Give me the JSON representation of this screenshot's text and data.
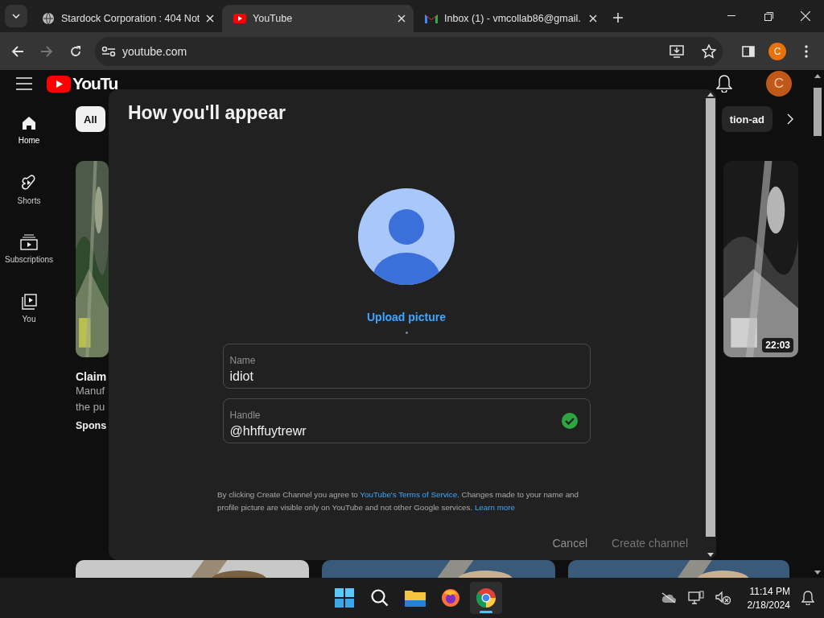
{
  "browser": {
    "tabs": [
      {
        "title": "Stardock Corporation : 404 Not",
        "kind": "globe",
        "selected": false
      },
      {
        "title": "YouTube",
        "kind": "youtube",
        "selected": true
      },
      {
        "title": "Inbox (1) - vmcollab86@gmail.",
        "kind": "gmail",
        "selected": false
      }
    ],
    "address": "youtube.com",
    "profile": "C"
  },
  "youtube": {
    "logo_text": "YouTu",
    "avatar": "C",
    "sidebar": [
      {
        "label": "Home",
        "kind": "home",
        "selected": true
      },
      {
        "label": "Shorts",
        "kind": "shorts",
        "selected": false
      },
      {
        "label": "Subscriptions",
        "kind": "subscriptions",
        "selected": false
      },
      {
        "label": "You",
        "kind": "you",
        "selected": false
      }
    ],
    "chips": [
      {
        "label": "All",
        "selected": true
      },
      {
        "label": "tion-ad",
        "selected": false
      }
    ],
    "left_video": {
      "title": "Claim",
      "description": [
        "Manuf",
        "the pu"
      ],
      "sponsor": "Spons"
    },
    "right_video": {
      "duration": "22:03"
    }
  },
  "dialog": {
    "title": "How you'll appear",
    "upload": "Upload picture",
    "fields": [
      {
        "label": "Name",
        "value": "idiot",
        "valid": false
      },
      {
        "label": "Handle",
        "value": "@hhffuytrewr",
        "valid": true
      }
    ],
    "legal": [
      {
        "text": "By clicking Create Channel you agree to ",
        "kind": "text"
      },
      {
        "text": "YouTube's Terms of Service",
        "kind": "link"
      },
      {
        "text": ". Changes made to your name and profile picture are visible only on YouTube and not other Google services. ",
        "kind": "text"
      },
      {
        "text": "Learn more",
        "kind": "link"
      }
    ],
    "buttons": [
      {
        "label": "Cancel",
        "disabled": false
      },
      {
        "label": "Create channel",
        "disabled": true
      }
    ]
  },
  "taskbar": {
    "apps": [
      {
        "kind": "start",
        "selected": false
      },
      {
        "kind": "search",
        "selected": false
      },
      {
        "kind": "files",
        "selected": false
      },
      {
        "kind": "firefox",
        "selected": false
      },
      {
        "kind": "chrome",
        "selected": true
      }
    ],
    "time": "11:14 PM",
    "date": "2/18/2024"
  }
}
